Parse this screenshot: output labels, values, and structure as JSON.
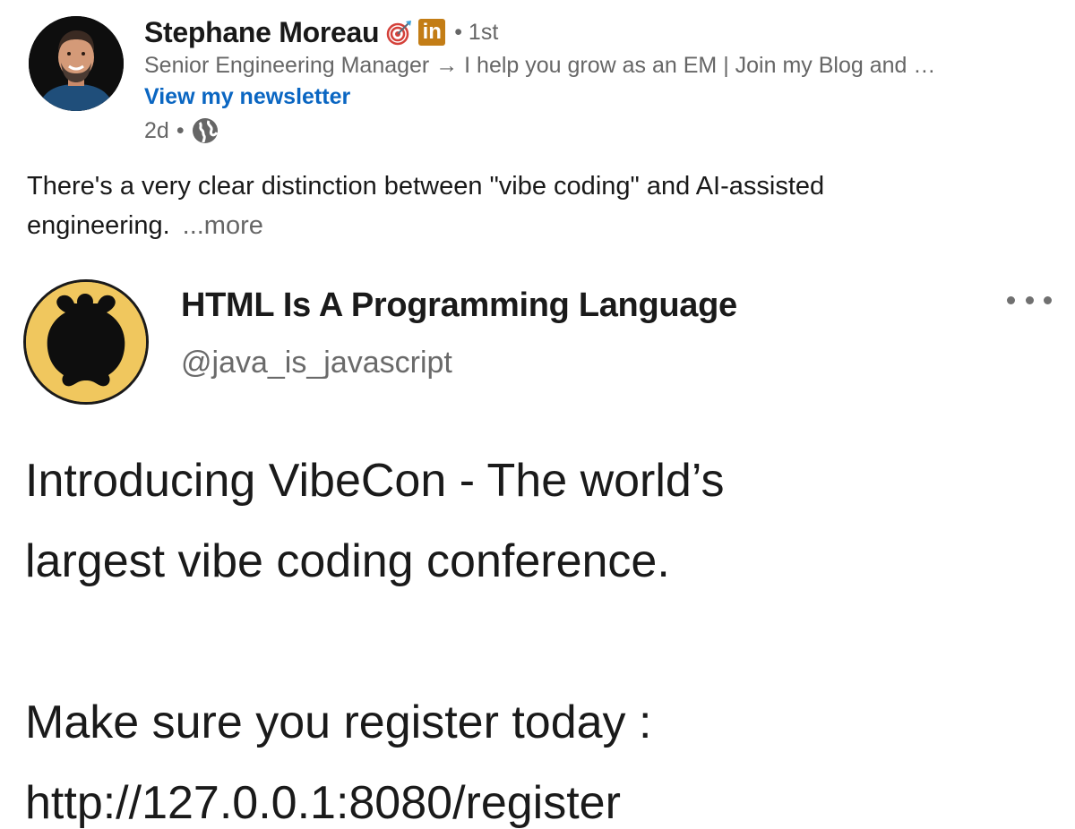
{
  "post": {
    "author": {
      "name": "Stephane Moreau",
      "badges": [
        "target-icon",
        "linkedin-icon"
      ],
      "linkedin_badge_text": "in",
      "degree": "• 1st",
      "headline": "Senior Engineering Manager → I help you grow as an EM | Join my Blog and …",
      "newsletter_link": "View my newsletter",
      "time": "2d",
      "separator": "•",
      "visibility_icon": "globe-icon"
    },
    "text_line1": "There's a very clear distinction between \"vibe coding\" and AI-assisted",
    "text_line2": "engineering.",
    "see_more": "...more"
  },
  "tweet": {
    "display_name": "HTML Is A Programming Language",
    "handle": "@java_is_javascript",
    "more_icon": "more-horizontal-icon",
    "lines": [
      "Introducing VibeCon - The world’s",
      "largest vibe coding conference.",
      "",
      "Make sure you register today :",
      "http://127.0.0.1:8080/register"
    ]
  },
  "colors": {
    "name": "#191919",
    "secondary": "#666666",
    "link": "#0a66c2",
    "linkedin_badge": "#c37d16",
    "tweet_avatar_bg": "#f0c75e"
  }
}
